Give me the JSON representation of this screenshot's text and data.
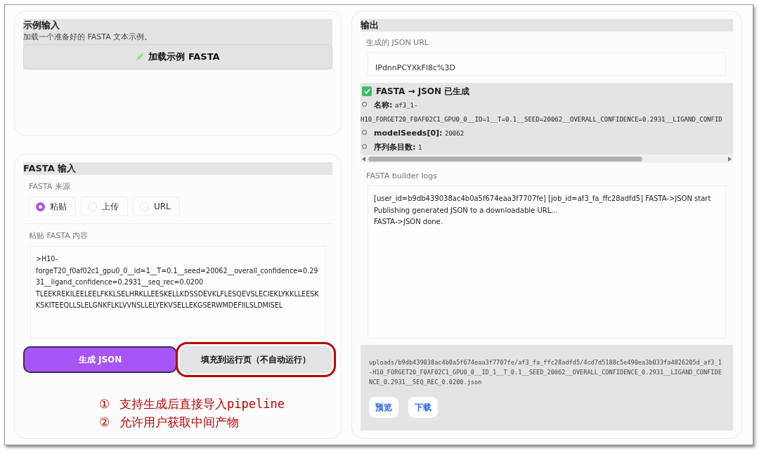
{
  "example_panel": {
    "title": "示例输入",
    "description": "加载一个准备好的 FASTA 文本示例。",
    "button": "加载示例 FASTA"
  },
  "input_panel": {
    "title": "FASTA 输入",
    "source_label": "FASTA 来源",
    "sources": [
      {
        "label": "粘贴",
        "selected": true
      },
      {
        "label": "上传",
        "selected": false
      },
      {
        "label": "URL",
        "selected": false
      }
    ],
    "content_label": "粘贴 FASTA 内容",
    "content": [
      ">H10-forgeT20_f0af02c1_gpu0_0__id=1__T=0.1__seed=20062__overall_confidence=0.2931__ligand_confidence=0.2931__seq_rec=0.0200",
      "TLEEKREKILEELEELFKKLSELHRKLLEESKELLKDSSDEVKLFLESQEVSLECIEKLYKKLLEESKKSKITEEQLLSLELGNKFLKLVVNSLLELYEKVSELLEKGSERWMDEFIILSLDMISEL"
    ],
    "buttons": [
      {
        "label": "生成 JSON",
        "kind": "primary",
        "highlighted": false
      },
      {
        "label": "填充到运行页（不自动运行）",
        "kind": "secondary",
        "highlighted": true
      }
    ]
  },
  "annotations": [
    {
      "number": "①",
      "text": "支持生成后直接导入pipeline"
    },
    {
      "number": "②",
      "text": "允许用户获取中间产物"
    }
  ],
  "output_panel": {
    "title": "输出",
    "url_label": "生成的 JSON URL",
    "url_value": "IPdnnPCYXkFl8c%3D",
    "summary": {
      "title": "FASTA → JSON 已生成",
      "checked": true,
      "items": [
        {
          "key": "名称:",
          "value": "af3_1-H10_FORGET20_F0AF02C1_GPU0_0__ID=1__T=0.1__SEED=20062__OVERALL_CONFIDENCE=0.2931__LIGAND_CONFID"
        },
        {
          "key": "modelSeeds[0]:",
          "value": "20062"
        },
        {
          "key": "序列条目数:",
          "value": "1"
        }
      ]
    },
    "logs_label": "FASTA builder logs",
    "logs": [
      "[user_id=b9db439038ac4b0a5f674eaa3f7707fe] [job_id=af3_fa_ffc28adfd5] FASTA->JSON start",
      "Publishing generated JSON to a downloadable URL...",
      "FASTA->JSON done."
    ],
    "file_path": "uploads/b9db439038ac4b0a5f674eaa3f7707fe/af3_fa_ffc28adfd5/4cd7d5188c5e490ea3b033fa4826205d_af3_1-H10_FORGET20_F0AF02C1_GPU0_0__ID_1__T_0.1__SEED_20062__OVERALL_CONFIDENCE_0.2931__LIGAND_CONFIDENCE_0.2931__SEQ_REC_0.0200.json",
    "file_buttons": [
      "预览",
      "下载"
    ]
  }
}
